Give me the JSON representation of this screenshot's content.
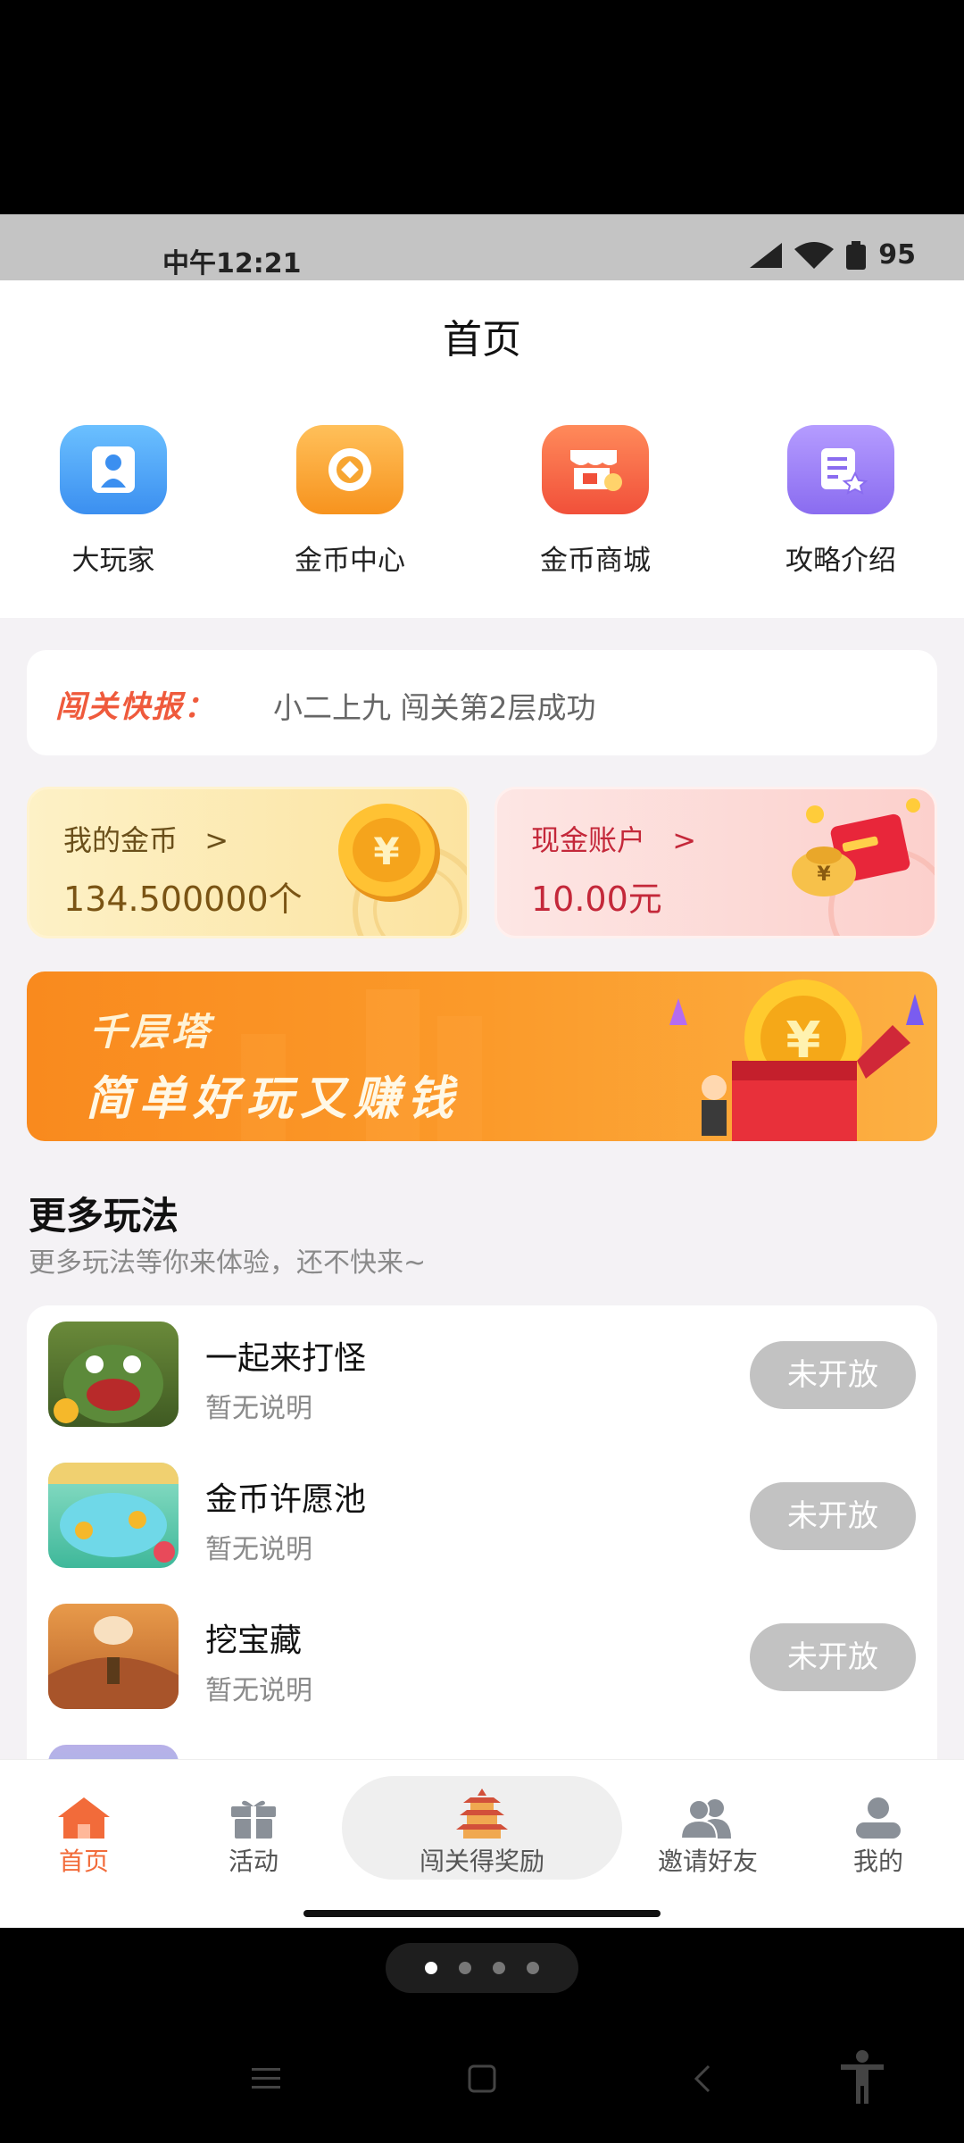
{
  "status_bar": {
    "time": "中午12:21",
    "battery": "95"
  },
  "header": {
    "title": "首页"
  },
  "quick_actions": [
    {
      "label": "大玩家",
      "icon": "player-icon",
      "color": "#4ea8f5"
    },
    {
      "label": "金币中心",
      "icon": "coin-center-icon",
      "color": "#f8a531"
    },
    {
      "label": "金币商城",
      "icon": "shop-icon",
      "color": "#f86a44"
    },
    {
      "label": "攻略介绍",
      "icon": "guide-icon",
      "color": "#9b7ff0"
    }
  ],
  "news": {
    "tag": "闯关快报：",
    "text": "小二上九 闯关第2层成功"
  },
  "coins_card": {
    "title": "我的金币",
    "arrow": ">",
    "value": "134.500000个"
  },
  "cash_card": {
    "title": "现金账户",
    "arrow": ">",
    "value": "10.00元"
  },
  "banner": {
    "line1": "千层塔",
    "line2": "简单好玩又赚钱"
  },
  "more": {
    "title": "更多玩法",
    "subtitle": "更多玩法等你来体验，还不快来~",
    "games": [
      {
        "name": "一起来打怪",
        "desc": "暂无说明",
        "button": "未开放"
      },
      {
        "name": "金币许愿池",
        "desc": "暂无说明",
        "button": "未开放"
      },
      {
        "name": "挖宝藏",
        "desc": "暂无说明",
        "button": "未开放"
      }
    ]
  },
  "bottom_nav": [
    {
      "label": "首页",
      "icon": "home-icon",
      "active": true
    },
    {
      "label": "活动",
      "icon": "gift-icon",
      "active": false
    },
    {
      "label": "闯关得奖励",
      "icon": "pagoda-icon",
      "active": false
    },
    {
      "label": "邀请好友",
      "icon": "friends-icon",
      "active": false
    },
    {
      "label": "我的",
      "icon": "profile-icon",
      "active": false
    }
  ],
  "colors": {
    "accent": "#f26b3a",
    "disabled_button": "#c2c2c2",
    "news_tag": "#ef5a3c"
  }
}
